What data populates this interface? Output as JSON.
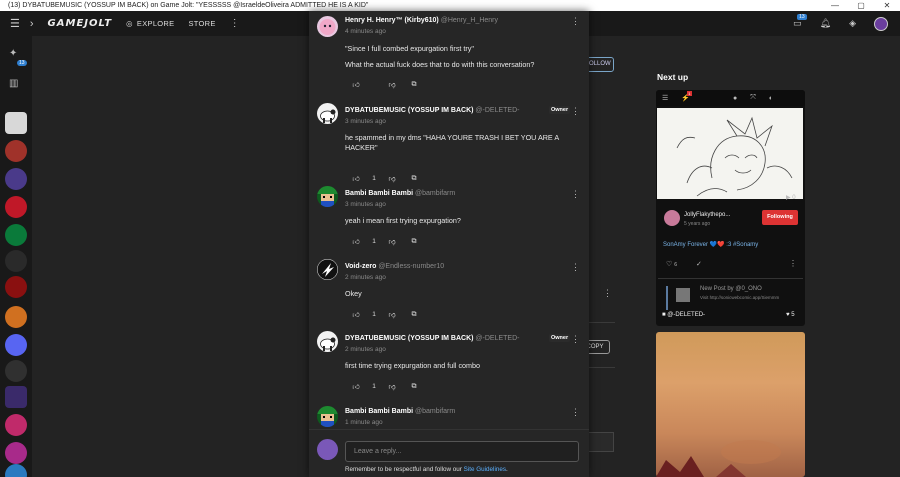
{
  "window": {
    "title": "(13) DYBATUBEMUSIC (YOSSUP IM BACK) on Game Jolt: \"YESSSSS @IsraeldeOliveira ADMITTED HE IS A KID\"",
    "controls": [
      "—",
      "▢",
      "✕"
    ]
  },
  "topbar": {
    "logo": "GAMEJOLT",
    "explore": "EXPLORE",
    "store": "STORE",
    "notif_count": "13"
  },
  "sidebar": {
    "badge": "13"
  },
  "background": {
    "follow_label": "FOLLOW",
    "copy_label": "COPY",
    "next_up": "Next up"
  },
  "next_card": {
    "badge": "1",
    "plays": "0",
    "author": "JollyFlakythepo...",
    "following_label": "Following",
    "time": "5 years ago",
    "caption": "SonAmy Forever 💙❤️ :3 #Sonamy",
    "like_count": "6",
    "embed_title": "New Post by @0_ONO",
    "embed_url": "Visit http://sonicwebcomic.app/Siemmm",
    "deleted_name": "@-DELETED-",
    "deleted_likes": "5"
  },
  "comments": [
    {
      "name": "Henry H. Henry™ (Kirby610)",
      "handle": "@Henry_H_Henry",
      "time": "4 minutes ago",
      "owner": "",
      "text": [
        "\"Since I full combed expurgation first try\"",
        "What the actual fuck does that to do with this conversation?"
      ],
      "likes": ""
    },
    {
      "name": "DYBATUBEMUSIC (YOSSUP IM BACK)",
      "handle": "@-DELETED-",
      "time": "3 minutes ago",
      "owner": "Owner",
      "text": [
        "he spammed in my dms \"HAHA YOURE TRASH I BET YOU ARE A HACKER\""
      ],
      "likes": "1"
    },
    {
      "name": "Bambi Bambi Bambi",
      "handle": "@bambifarm",
      "time": "3 minutes ago",
      "owner": "",
      "text": [
        "yeah i mean first trying expurgation?"
      ],
      "likes": "1"
    },
    {
      "name": "Void-zero",
      "handle": "@Endless-number10",
      "time": "2 minutes ago",
      "owner": "",
      "text": [
        "Okey"
      ],
      "likes": "1"
    },
    {
      "name": "DYBATUBEMUSIC (YOSSUP IM BACK)",
      "handle": "@-DELETED-",
      "time": "2 minutes ago",
      "owner": "Owner",
      "text": [
        "first time trying expurgation and full combo"
      ],
      "likes": "1"
    },
    {
      "name": "Bambi Bambi Bambi",
      "handle": "@bambifarm",
      "time": "1 minute ago",
      "owner": "",
      "text": [],
      "likes": ""
    }
  ],
  "reply": {
    "placeholder": "Leave a reply...",
    "guidelines_text": "Remember to be respectful and follow our",
    "guidelines_link": "Site Guidelines",
    "guidelines_end": "."
  }
}
